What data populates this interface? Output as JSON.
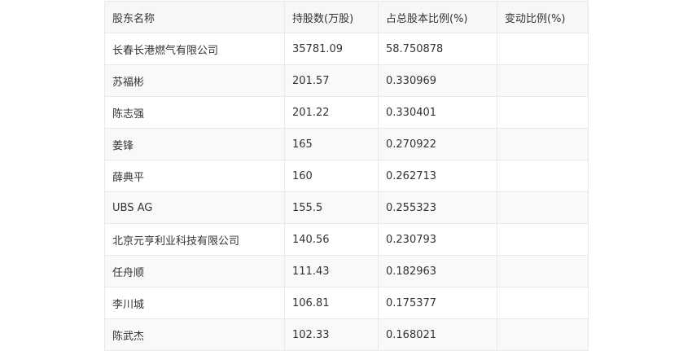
{
  "table": {
    "headers": [
      "股东名称",
      "持股数(万股)",
      "占总股本比例(%)",
      "变动比例(%)"
    ],
    "rows": [
      [
        "长春长港燃气有限公司",
        "35781.09",
        "58.750878",
        ""
      ],
      [
        "苏福彬",
        "201.57",
        "0.330969",
        ""
      ],
      [
        "陈志强",
        "201.22",
        "0.330401",
        ""
      ],
      [
        "姜锋",
        "165",
        "0.270922",
        ""
      ],
      [
        "薛典平",
        "160",
        "0.262713",
        ""
      ],
      [
        "UBS AG",
        "155.5",
        "0.255323",
        ""
      ],
      [
        "北京元亨利业科技有限公司",
        "140.56",
        "0.230793",
        ""
      ],
      [
        "任舟顺",
        "111.43",
        "0.182963",
        ""
      ],
      [
        "李川城",
        "106.81",
        "0.175377",
        ""
      ],
      [
        "陈武杰",
        "102.33",
        "0.168021",
        ""
      ]
    ]
  }
}
